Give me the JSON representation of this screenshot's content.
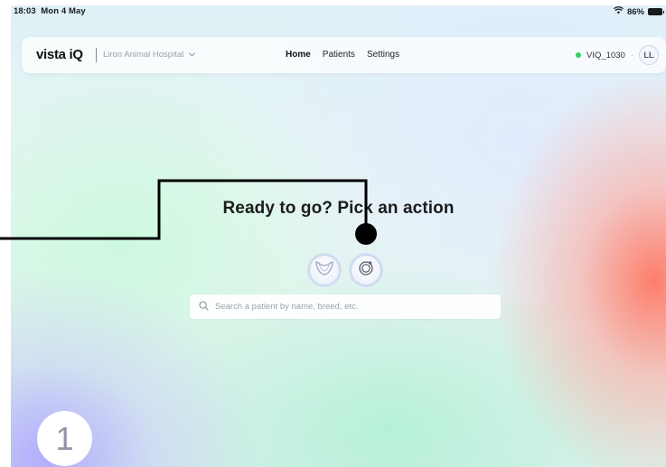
{
  "statusbar": {
    "time": "18:03",
    "date": "Mon 4 May",
    "battery": "86%",
    "icons": [
      "wifi-icon",
      "battery-icon"
    ]
  },
  "navbar": {
    "logo": "vista iQ",
    "hospital": "Liron Animal Hospital",
    "tabs": [
      {
        "label": "Home",
        "active": true
      },
      {
        "label": "Patients",
        "active": false
      },
      {
        "label": "Settings",
        "active": false
      }
    ],
    "device_id": "VIQ_1030",
    "device_status_color": "#2fcf6a",
    "user_initials": "LL"
  },
  "main": {
    "heading": "Ready to go? Pick an action",
    "actions": [
      {
        "icon": "dental-tooth-icon"
      },
      {
        "icon": "new-scan-icon"
      }
    ],
    "search_placeholder": "Search a patient by name, breed, etc."
  },
  "overlay": {
    "step_number": "1",
    "callout_target": "new-scan-button"
  }
}
